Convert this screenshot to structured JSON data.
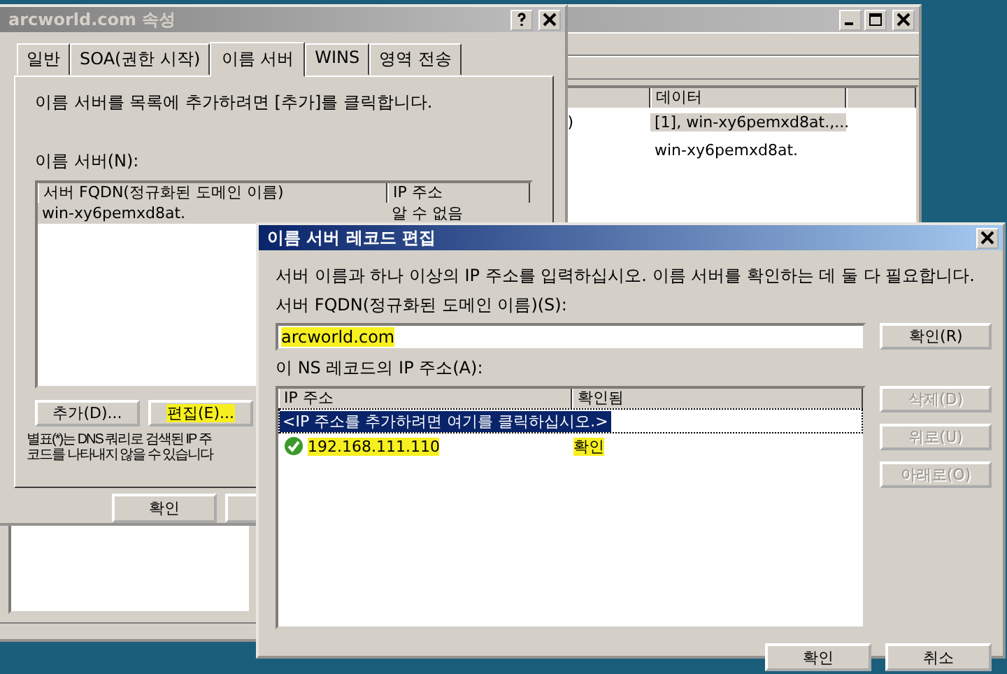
{
  "background_window": {
    "list": {
      "columns": [
        "데이터"
      ],
      "rows": [
        {
          "column_1": ")",
          "data": "[1], win-xy6pemxd8at.,...",
          "selected": true
        },
        {
          "data": "win-xy6pemxd8at.",
          "selected": false
        }
      ]
    }
  },
  "properties_dialog": {
    "title": "arcworld.com 속성",
    "tabs": [
      {
        "label": "일반",
        "selected": false
      },
      {
        "label": "SOA(권한 시작)",
        "selected": false
      },
      {
        "label": "이름 서버",
        "selected": true
      },
      {
        "label": "WINS",
        "selected": false
      },
      {
        "label": "영역 전송",
        "selected": false
      }
    ],
    "instruction": "이름 서버를 목록에 추가하려면 [추가]를 클릭합니다.",
    "list_label": "이름 서버(N):",
    "list": {
      "columns": [
        "서버 FQDN(정규화된 도메인 이름)",
        "IP 주소"
      ],
      "rows": [
        {
          "fqdn": "win-xy6pemxd8at.",
          "ip": "알 수 없음",
          "selected": true
        }
      ]
    },
    "buttons": [
      {
        "label": "추가(D)...",
        "highlighted": false
      },
      {
        "label": "편집(E)...",
        "highlighted": true
      }
    ],
    "note_lines": [
      "별표(*)는 DNS 쿼리로 검색된 IP 주",
      "코드를 나타내지 않을 수 있습니다"
    ],
    "footer_buttons": [
      "확인"
    ]
  },
  "edit_dialog": {
    "title": "이름 서버 레코드 편집",
    "description": "서버 이름과 하나 이상의 IP 주소를 입력하십시오. 이름 서버를 확인하는 데 둘 다 필요합니다.",
    "fqdn_label": "서버 FQDN(정규화된 도메인 이름)(S):",
    "fqdn_field": {
      "value": "arcworld.com",
      "highlighted": true
    },
    "resolve_button": "확인(R)",
    "ip_label": "이 NS 레코드의 IP 주소(A):",
    "ip_list": {
      "columns": [
        "IP 주소",
        "확인됨"
      ],
      "rows": [
        {
          "kind": "prompt",
          "text": "<IP 주소를 추가하려면 여기를 클릭하십시오.>",
          "selected": true
        },
        {
          "kind": "address",
          "address": "192.168.111.110",
          "status": "확인",
          "verified": true,
          "highlighted": true,
          "selected": false
        }
      ]
    },
    "side_buttons": [
      {
        "label": "삭제(D)",
        "disabled": true
      },
      {
        "label": "위로(U)",
        "disabled": true
      },
      {
        "label": "아래로(O)",
        "disabled": true
      }
    ],
    "footer_buttons": [
      "확인",
      "취소"
    ]
  }
}
